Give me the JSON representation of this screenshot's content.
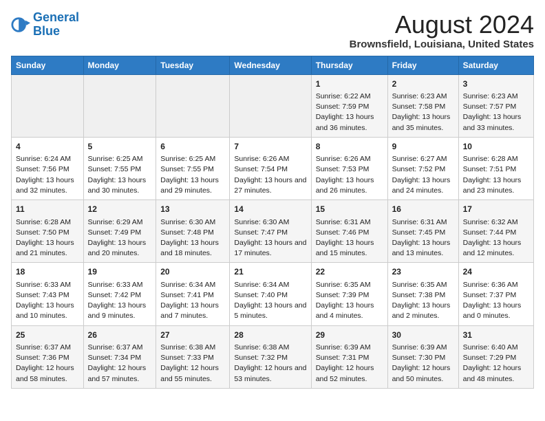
{
  "logo": {
    "line1": "General",
    "line2": "Blue"
  },
  "title": "August 2024",
  "subtitle": "Brownsfield, Louisiana, United States",
  "days_of_week": [
    "Sunday",
    "Monday",
    "Tuesday",
    "Wednesday",
    "Thursday",
    "Friday",
    "Saturday"
  ],
  "weeks": [
    [
      {
        "day": "",
        "sunrise": "",
        "sunset": "",
        "daylight": ""
      },
      {
        "day": "",
        "sunrise": "",
        "sunset": "",
        "daylight": ""
      },
      {
        "day": "",
        "sunrise": "",
        "sunset": "",
        "daylight": ""
      },
      {
        "day": "",
        "sunrise": "",
        "sunset": "",
        "daylight": ""
      },
      {
        "day": "1",
        "sunrise": "Sunrise: 6:22 AM",
        "sunset": "Sunset: 7:59 PM",
        "daylight": "Daylight: 13 hours and 36 minutes."
      },
      {
        "day": "2",
        "sunrise": "Sunrise: 6:23 AM",
        "sunset": "Sunset: 7:58 PM",
        "daylight": "Daylight: 13 hours and 35 minutes."
      },
      {
        "day": "3",
        "sunrise": "Sunrise: 6:23 AM",
        "sunset": "Sunset: 7:57 PM",
        "daylight": "Daylight: 13 hours and 33 minutes."
      }
    ],
    [
      {
        "day": "4",
        "sunrise": "Sunrise: 6:24 AM",
        "sunset": "Sunset: 7:56 PM",
        "daylight": "Daylight: 13 hours and 32 minutes."
      },
      {
        "day": "5",
        "sunrise": "Sunrise: 6:25 AM",
        "sunset": "Sunset: 7:55 PM",
        "daylight": "Daylight: 13 hours and 30 minutes."
      },
      {
        "day": "6",
        "sunrise": "Sunrise: 6:25 AM",
        "sunset": "Sunset: 7:55 PM",
        "daylight": "Daylight: 13 hours and 29 minutes."
      },
      {
        "day": "7",
        "sunrise": "Sunrise: 6:26 AM",
        "sunset": "Sunset: 7:54 PM",
        "daylight": "Daylight: 13 hours and 27 minutes."
      },
      {
        "day": "8",
        "sunrise": "Sunrise: 6:26 AM",
        "sunset": "Sunset: 7:53 PM",
        "daylight": "Daylight: 13 hours and 26 minutes."
      },
      {
        "day": "9",
        "sunrise": "Sunrise: 6:27 AM",
        "sunset": "Sunset: 7:52 PM",
        "daylight": "Daylight: 13 hours and 24 minutes."
      },
      {
        "day": "10",
        "sunrise": "Sunrise: 6:28 AM",
        "sunset": "Sunset: 7:51 PM",
        "daylight": "Daylight: 13 hours and 23 minutes."
      }
    ],
    [
      {
        "day": "11",
        "sunrise": "Sunrise: 6:28 AM",
        "sunset": "Sunset: 7:50 PM",
        "daylight": "Daylight: 13 hours and 21 minutes."
      },
      {
        "day": "12",
        "sunrise": "Sunrise: 6:29 AM",
        "sunset": "Sunset: 7:49 PM",
        "daylight": "Daylight: 13 hours and 20 minutes."
      },
      {
        "day": "13",
        "sunrise": "Sunrise: 6:30 AM",
        "sunset": "Sunset: 7:48 PM",
        "daylight": "Daylight: 13 hours and 18 minutes."
      },
      {
        "day": "14",
        "sunrise": "Sunrise: 6:30 AM",
        "sunset": "Sunset: 7:47 PM",
        "daylight": "Daylight: 13 hours and 17 minutes."
      },
      {
        "day": "15",
        "sunrise": "Sunrise: 6:31 AM",
        "sunset": "Sunset: 7:46 PM",
        "daylight": "Daylight: 13 hours and 15 minutes."
      },
      {
        "day": "16",
        "sunrise": "Sunrise: 6:31 AM",
        "sunset": "Sunset: 7:45 PM",
        "daylight": "Daylight: 13 hours and 13 minutes."
      },
      {
        "day": "17",
        "sunrise": "Sunrise: 6:32 AM",
        "sunset": "Sunset: 7:44 PM",
        "daylight": "Daylight: 13 hours and 12 minutes."
      }
    ],
    [
      {
        "day": "18",
        "sunrise": "Sunrise: 6:33 AM",
        "sunset": "Sunset: 7:43 PM",
        "daylight": "Daylight: 13 hours and 10 minutes."
      },
      {
        "day": "19",
        "sunrise": "Sunrise: 6:33 AM",
        "sunset": "Sunset: 7:42 PM",
        "daylight": "Daylight: 13 hours and 9 minutes."
      },
      {
        "day": "20",
        "sunrise": "Sunrise: 6:34 AM",
        "sunset": "Sunset: 7:41 PM",
        "daylight": "Daylight: 13 hours and 7 minutes."
      },
      {
        "day": "21",
        "sunrise": "Sunrise: 6:34 AM",
        "sunset": "Sunset: 7:40 PM",
        "daylight": "Daylight: 13 hours and 5 minutes."
      },
      {
        "day": "22",
        "sunrise": "Sunrise: 6:35 AM",
        "sunset": "Sunset: 7:39 PM",
        "daylight": "Daylight: 13 hours and 4 minutes."
      },
      {
        "day": "23",
        "sunrise": "Sunrise: 6:35 AM",
        "sunset": "Sunset: 7:38 PM",
        "daylight": "Daylight: 13 hours and 2 minutes."
      },
      {
        "day": "24",
        "sunrise": "Sunrise: 6:36 AM",
        "sunset": "Sunset: 7:37 PM",
        "daylight": "Daylight: 13 hours and 0 minutes."
      }
    ],
    [
      {
        "day": "25",
        "sunrise": "Sunrise: 6:37 AM",
        "sunset": "Sunset: 7:36 PM",
        "daylight": "Daylight: 12 hours and 58 minutes."
      },
      {
        "day": "26",
        "sunrise": "Sunrise: 6:37 AM",
        "sunset": "Sunset: 7:34 PM",
        "daylight": "Daylight: 12 hours and 57 minutes."
      },
      {
        "day": "27",
        "sunrise": "Sunrise: 6:38 AM",
        "sunset": "Sunset: 7:33 PM",
        "daylight": "Daylight: 12 hours and 55 minutes."
      },
      {
        "day": "28",
        "sunrise": "Sunrise: 6:38 AM",
        "sunset": "Sunset: 7:32 PM",
        "daylight": "Daylight: 12 hours and 53 minutes."
      },
      {
        "day": "29",
        "sunrise": "Sunrise: 6:39 AM",
        "sunset": "Sunset: 7:31 PM",
        "daylight": "Daylight: 12 hours and 52 minutes."
      },
      {
        "day": "30",
        "sunrise": "Sunrise: 6:39 AM",
        "sunset": "Sunset: 7:30 PM",
        "daylight": "Daylight: 12 hours and 50 minutes."
      },
      {
        "day": "31",
        "sunrise": "Sunrise: 6:40 AM",
        "sunset": "Sunset: 7:29 PM",
        "daylight": "Daylight: 12 hours and 48 minutes."
      }
    ]
  ]
}
